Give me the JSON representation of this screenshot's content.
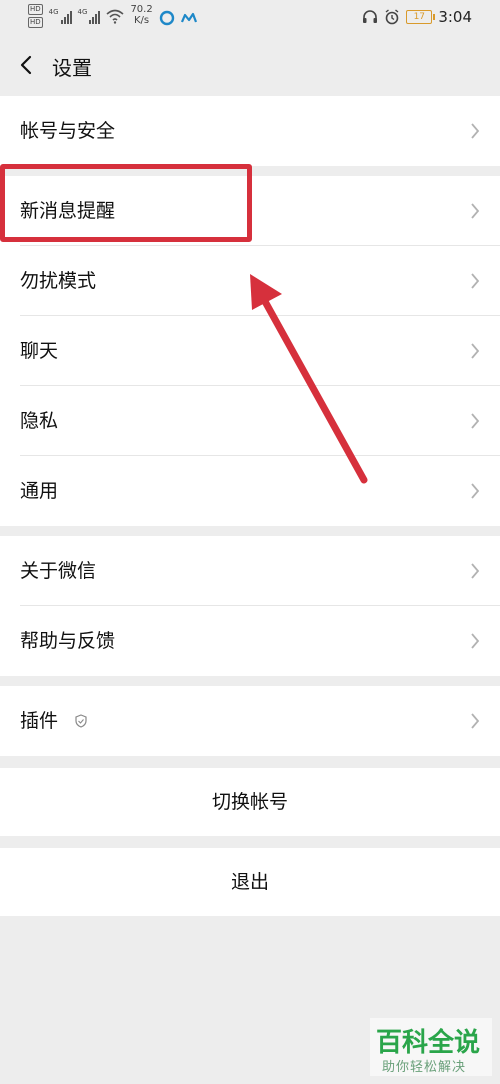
{
  "status_bar": {
    "hd1": "HD",
    "hd2": "HD",
    "net1": "4G",
    "net2": "4G",
    "speed_value": "70.2",
    "speed_unit": "K/s",
    "battery": "17",
    "time": "3:04"
  },
  "header": {
    "title": "设置"
  },
  "groups": [
    {
      "items": [
        {
          "label": "帐号与安全"
        }
      ]
    },
    {
      "items": [
        {
          "label": "新消息提醒"
        },
        {
          "label": "勿扰模式"
        },
        {
          "label": "聊天"
        },
        {
          "label": "隐私"
        },
        {
          "label": "通用"
        }
      ]
    },
    {
      "items": [
        {
          "label": "关于微信"
        },
        {
          "label": "帮助与反馈"
        }
      ]
    },
    {
      "items": [
        {
          "label": "插件"
        }
      ]
    }
  ],
  "actions": {
    "switch_account": "切换帐号",
    "logout": "退出"
  },
  "watermark": {
    "brand": "百科全说",
    "slogan": "助你轻松解决"
  },
  "colors": {
    "background": "#ededed",
    "annotation_red": "#d6303c",
    "watermark_green": "#2aa54a"
  }
}
